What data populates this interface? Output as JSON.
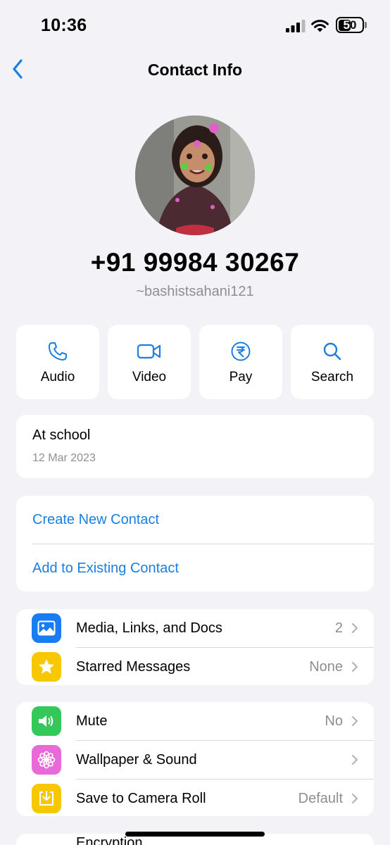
{
  "status_bar": {
    "time": "10:36",
    "battery_level": "50"
  },
  "nav": {
    "title": "Contact Info",
    "back_icon": "chevron-left-icon"
  },
  "profile": {
    "phone": "+91 99984 30267",
    "username": "~bashistsahani121"
  },
  "actions": [
    {
      "label": "Audio",
      "icon": "phone-icon"
    },
    {
      "label": "Video",
      "icon": "video-camera-icon"
    },
    {
      "label": "Pay",
      "icon": "rupee-icon"
    },
    {
      "label": "Search",
      "icon": "search-icon"
    }
  ],
  "about": {
    "text": "At school",
    "date": "12 Mar 2023"
  },
  "contact_actions": {
    "create": "Create New Contact",
    "add_existing": "Add to Existing Contact"
  },
  "media_section": [
    {
      "label": "Media, Links, and Docs",
      "value": "2",
      "icon": "photo-icon",
      "color": "#1a7cf2"
    },
    {
      "label": "Starred Messages",
      "value": "None",
      "icon": "star-icon",
      "color": "#f7c800"
    }
  ],
  "settings_section": [
    {
      "label": "Mute",
      "value": "No",
      "icon": "speaker-icon",
      "color": "#34c759"
    },
    {
      "label": "Wallpaper & Sound",
      "value": "",
      "icon": "flower-icon",
      "color": "#e86ad8"
    },
    {
      "label": "Save to Camera Roll",
      "value": "Default",
      "icon": "download-icon",
      "color": "#f7c800"
    }
  ],
  "next_row_peek": "Encryption",
  "colors": {
    "accent": "#1a7fe0",
    "background": "#f2f2f7",
    "card": "#ffffff",
    "secondary_text": "#8e8e93"
  }
}
